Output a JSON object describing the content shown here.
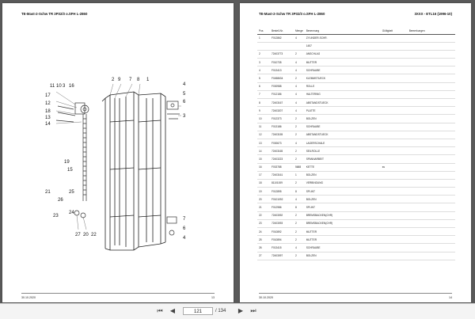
{
  "left_page": {
    "header": "TE-Mast-2-Schw TR 3P32/3 o.SFH L-2860",
    "footer_date": "30.10.2020",
    "page_number": "13",
    "callouts_left": [
      "11",
      "10",
      "3",
      "16",
      "17",
      "12",
      "18",
      "13",
      "14",
      "21"
    ],
    "callouts_top": [
      "2",
      "9",
      "7",
      "8",
      "1"
    ],
    "callouts_right": [
      "4",
      "5",
      "6",
      "3"
    ],
    "callouts_bottom": [
      "27",
      "20",
      "22"
    ],
    "callouts_lower_right": [
      "7",
      "6",
      "4"
    ],
    "callouts_misc": [
      "19",
      "15",
      "25",
      "26",
      "23",
      "24"
    ]
  },
  "right_page": {
    "header": "3XXX - ETL16 (1996-10)",
    "footer_date": "30.10.2020",
    "page_number": "14",
    "columns": [
      "Pos",
      "Bestell-Nr.",
      "Menge",
      "Benennung",
      "",
      "Gültigkeit",
      "Bemerkungen"
    ],
    "rows": [
      {
        "pos": "1",
        "nr": "F012862",
        "qty": "4",
        "desc": "ZYLINDER-SCHR.",
        "note": "",
        "valid": ""
      },
      {
        "pos": "",
        "nr": "",
        "qty": "",
        "desc": "1457",
        "note": "",
        "valid": ""
      },
      {
        "pos": "2",
        "nr": "72403773",
        "qty": "2",
        "desc": "ANSCHLAG",
        "note": "",
        "valid": ""
      },
      {
        "pos": "3",
        "nr": "F010735",
        "qty": "4",
        "desc": "MUTTER",
        "note": "",
        "valid": ""
      },
      {
        "pos": "4",
        "nr": "F013413",
        "qty": "4",
        "desc": "SCHRAUBE",
        "note": "",
        "valid": ""
      },
      {
        "pos": "5",
        "nr": "F0458634",
        "qty": "2",
        "desc": "KLEMMSTUECK",
        "note": "",
        "valid": ""
      },
      {
        "pos": "6",
        "nr": "F000988",
        "qty": "4",
        "desc": "ROLLE",
        "note": "",
        "valid": ""
      },
      {
        "pos": "7",
        "nr": "F012186",
        "qty": "4",
        "desc": "HALTERING",
        "note": "",
        "valid": ""
      },
      {
        "pos": "8",
        "nr": "72403167",
        "qty": "4",
        "desc": "ABSTANDSTUECK",
        "note": "",
        "valid": ""
      },
      {
        "pos": "9",
        "nr": "72403207",
        "qty": "4",
        "desc": "PLATTE",
        "note": "",
        "valid": ""
      },
      {
        "pos": "10",
        "nr": "F012373",
        "qty": "2",
        "desc": "BOLZEN",
        "note": "",
        "valid": ""
      },
      {
        "pos": "11",
        "nr": "F013186",
        "qty": "2",
        "desc": "SCHRAUBE",
        "note": "",
        "valid": ""
      },
      {
        "pos": "12",
        "nr": "72403155",
        "qty": "2",
        "desc": "ABSTANDSTUECK",
        "note": "",
        "valid": ""
      },
      {
        "pos": "13",
        "nr": "F000673",
        "qty": "4",
        "desc": "LAGERSCHALE",
        "note": "",
        "valid": ""
      },
      {
        "pos": "14",
        "nr": "72403165",
        "qty": "2",
        "desc": "SEILROLLE",
        "note": "",
        "valid": ""
      },
      {
        "pos": "15",
        "nr": "72403223",
        "qty": "2",
        "desc": "SPANNARBEIT",
        "note": "",
        "valid": ""
      },
      {
        "pos": "16",
        "nr": "F002788",
        "qty": "5688",
        "desc": "KETTE",
        "note": "",
        "valid": "ss"
      },
      {
        "pos": "17",
        "nr": "72403161",
        "qty": "1",
        "desc": "BOLZEN",
        "note": "",
        "valid": ""
      },
      {
        "pos": "18",
        "nr": "81101009",
        "qty": "2",
        "desc": "VERBINDUNG",
        "note": "",
        "valid": ""
      },
      {
        "pos": "19",
        "nr": "F012895",
        "qty": "8",
        "desc": "SPLINT",
        "note": "",
        "valid": ""
      },
      {
        "pos": "20",
        "nr": "F0101092",
        "qty": "4",
        "desc": "BOLZEN",
        "note": "",
        "valid": ""
      },
      {
        "pos": "21",
        "nr": "F012986",
        "qty": "8",
        "desc": "SPLINT",
        "note": "",
        "valid": ""
      },
      {
        "pos": "22",
        "nr": "72403092",
        "qty": "2",
        "desc": "BREMSBACKEN(CHR)",
        "note": "",
        "valid": ""
      },
      {
        "pos": "23",
        "nr": "72403093",
        "qty": "2",
        "desc": "BREMSBACKEN(CHR)",
        "note": "",
        "valid": ""
      },
      {
        "pos": "24",
        "nr": "F010892",
        "qty": "2",
        "desc": "MUTTER",
        "note": "",
        "valid": ""
      },
      {
        "pos": "25",
        "nr": "F010894",
        "qty": "2",
        "desc": "MUTTER",
        "note": "",
        "valid": ""
      },
      {
        "pos": "26",
        "nr": "F013415",
        "qty": "4",
        "desc": "SCHRAUBE",
        "note": "",
        "valid": ""
      },
      {
        "pos": "27",
        "nr": "72403097",
        "qty": "2",
        "desc": "BOLZEN",
        "note": "",
        "valid": ""
      }
    ]
  },
  "toolbar": {
    "current_page": "121",
    "total_pages": "/ 134"
  },
  "colors": {
    "background": "#5a5a5a",
    "toolbar": "#f4f4f4"
  }
}
